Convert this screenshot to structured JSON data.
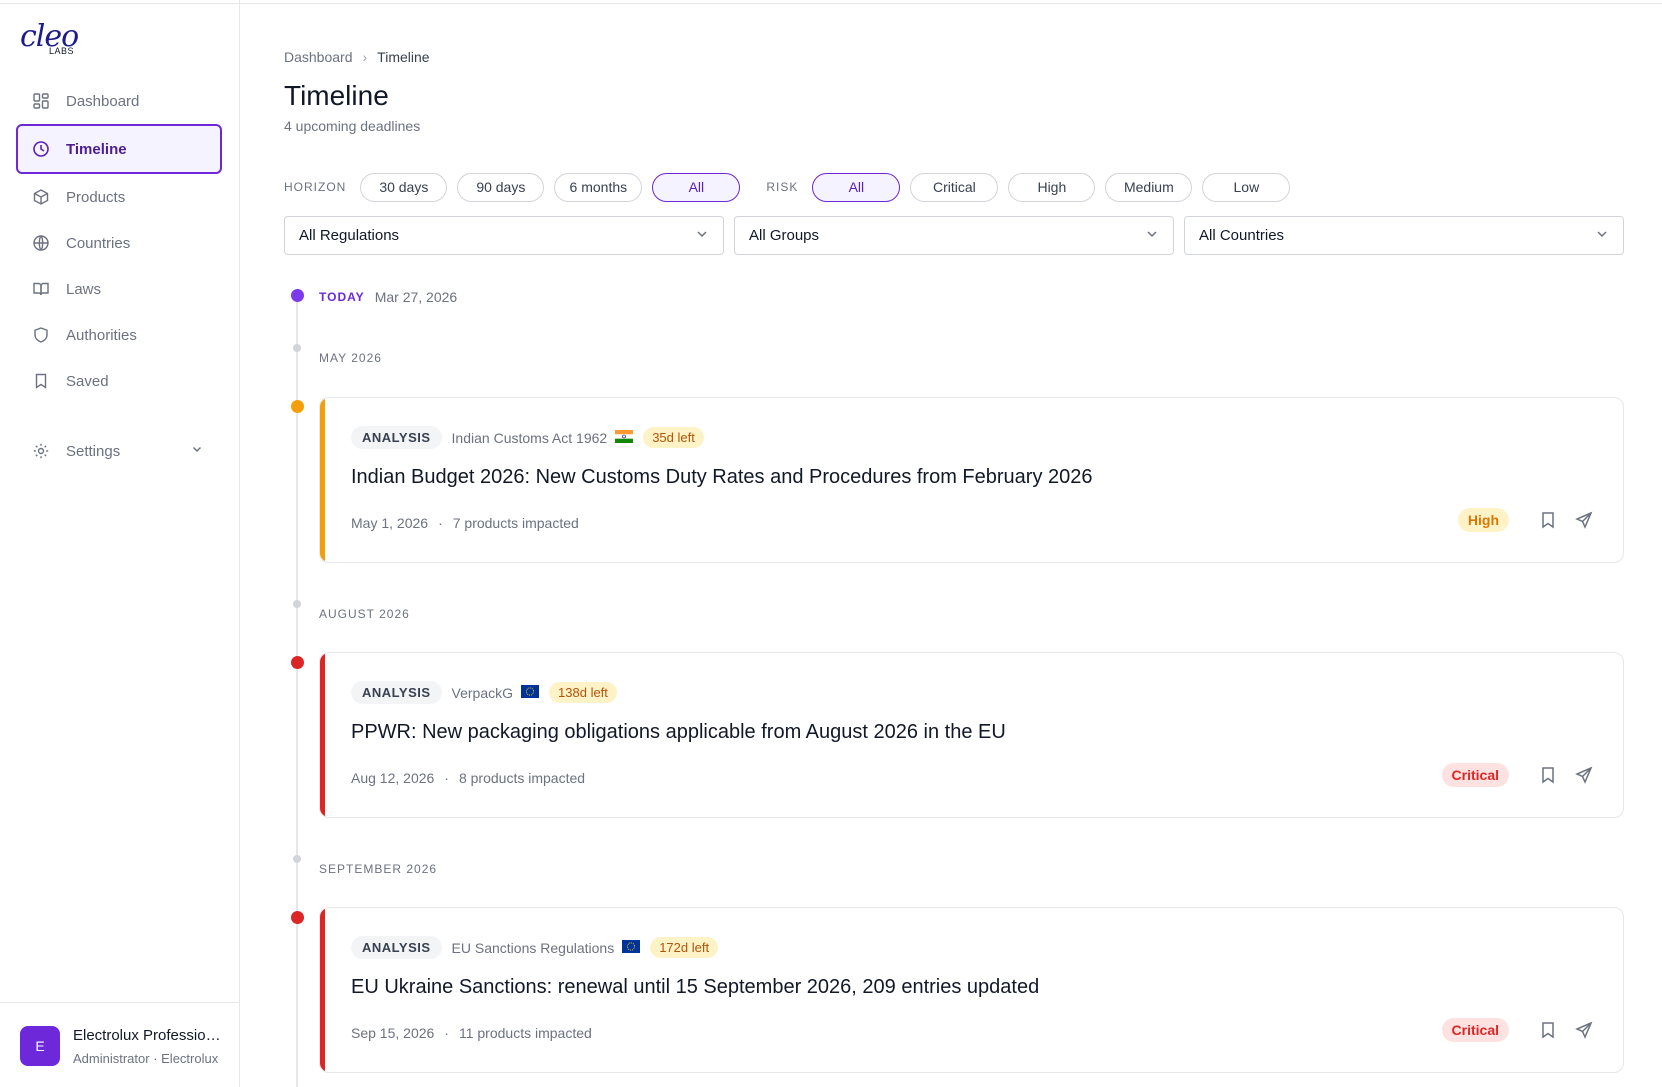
{
  "brand": {
    "logo_word": "cleo",
    "logo_sub": "LABS"
  },
  "sidebar": {
    "items": [
      {
        "label": "Dashboard",
        "icon": "grid-icon"
      },
      {
        "label": "Timeline",
        "icon": "clock-icon",
        "active": true
      },
      {
        "label": "Products",
        "icon": "box-icon"
      },
      {
        "label": "Countries",
        "icon": "globe-icon"
      },
      {
        "label": "Laws",
        "icon": "book-icon"
      },
      {
        "label": "Authorities",
        "icon": "shield-icon"
      },
      {
        "label": "Saved",
        "icon": "bookmark-icon"
      }
    ],
    "settings": {
      "label": "Settings",
      "icon": "gear-icon"
    }
  },
  "profile": {
    "initial": "E",
    "name": "Electrolux Professional",
    "role": "Administrator · Electrolux"
  },
  "breadcrumb": {
    "root": "Dashboard",
    "current": "Timeline"
  },
  "page": {
    "title": "Timeline",
    "subtitle": "4 upcoming deadlines"
  },
  "filters": {
    "horizon_label": "HORIZON",
    "horizon": [
      "30 days",
      "90 days",
      "6 months",
      "All"
    ],
    "horizon_selected": "All",
    "risk_label": "RISK",
    "risk": [
      "All",
      "Critical",
      "High",
      "Medium",
      "Low"
    ],
    "risk_selected": "All"
  },
  "selects": {
    "regulations": "All Regulations",
    "groups": "All Groups",
    "countries": "All Countries"
  },
  "timeline": {
    "today_label": "TODAY",
    "today_date": "Mar 27, 2026",
    "groups": [
      {
        "month": "MAY 2026",
        "card": {
          "tag": "ANALYSIS",
          "law": "Indian Customs Act 1962",
          "flag": "india-flag",
          "days_left": "35d left",
          "title": "Indian Budget 2026: New Customs Duty Rates and Procedures from February 2026",
          "date": "May 1, 2026",
          "impact": "7 products impacted",
          "risk": "High",
          "accent": "#f59e0b"
        }
      },
      {
        "month": "AUGUST 2026",
        "card": {
          "tag": "ANALYSIS",
          "law": "VerpackG",
          "flag": "eu-flag",
          "days_left": "138d left",
          "title": "PPWR: New packaging obligations applicable from August 2026 in the EU",
          "date": "Aug 12, 2026",
          "impact": "8 products impacted",
          "risk": "Critical",
          "accent": "#dc2626"
        }
      },
      {
        "month": "SEPTEMBER 2026",
        "card": {
          "tag": "ANALYSIS",
          "law": "EU Sanctions Regulations",
          "flag": "eu-flag",
          "days_left": "172d left",
          "title": "EU Ukraine Sanctions: renewal until 15 September 2026, 209 entries updated",
          "date": "Sep 15, 2026",
          "impact": "11 products impacted",
          "risk": "Critical",
          "accent": "#dc2626"
        }
      }
    ]
  },
  "colors": {
    "accent": "#6d28d9",
    "high": "#f59e0b",
    "critical": "#dc2626",
    "today": "#7c3aed"
  }
}
